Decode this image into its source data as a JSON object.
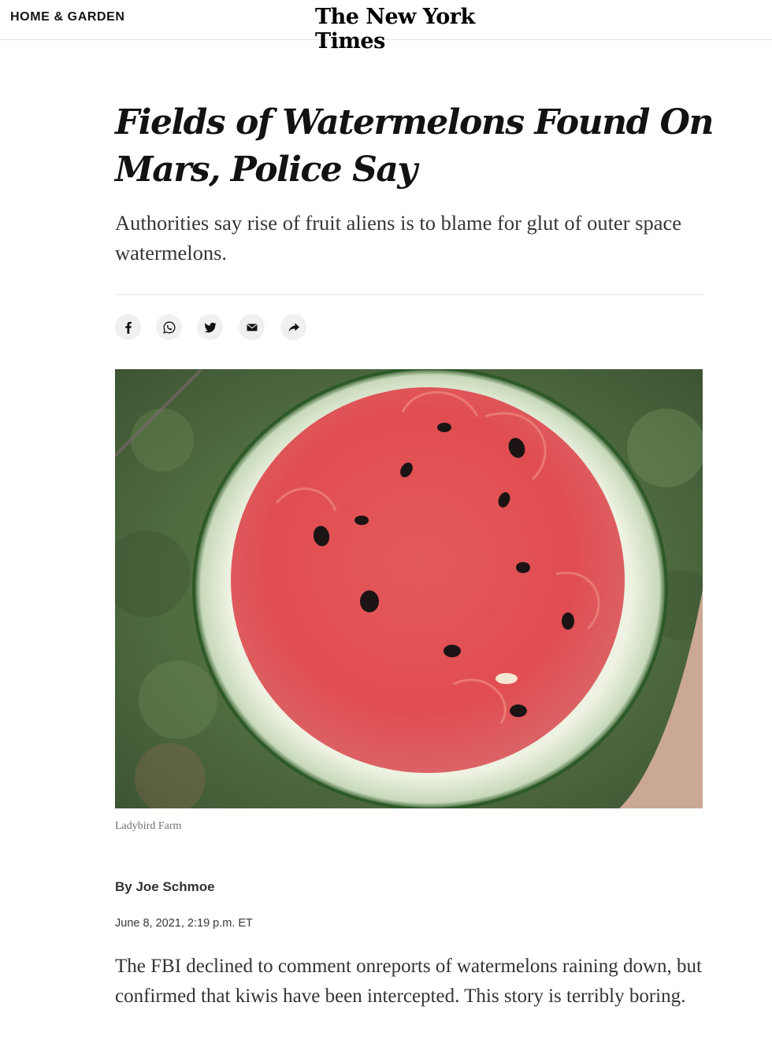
{
  "header": {
    "section": "HOME & GARDEN",
    "logo": "The New York Times"
  },
  "article": {
    "headline": "Fields of Watermelons Found On Mars, Police Say",
    "summary": "Authorities say rise of fruit aliens is to blame for glut of outer space watermelons.",
    "share_icons": [
      "facebook-icon",
      "whatsapp-icon",
      "twitter-icon",
      "email-icon",
      "share-icon"
    ],
    "image_credit": "Ladybird Farm",
    "byline": "By Joe Schmoe",
    "timestamp": "June 8, 2021, 2:19 p.m. ET",
    "body": "The FBI declined to comment onreports of watermelons raining down, but confirmed that kiwis have been intercepted. This story is terribly boring."
  },
  "colors": {
    "text": "#121212",
    "rule": "#e2e2e2",
    "share_button_bg": "#f0f0f0"
  }
}
